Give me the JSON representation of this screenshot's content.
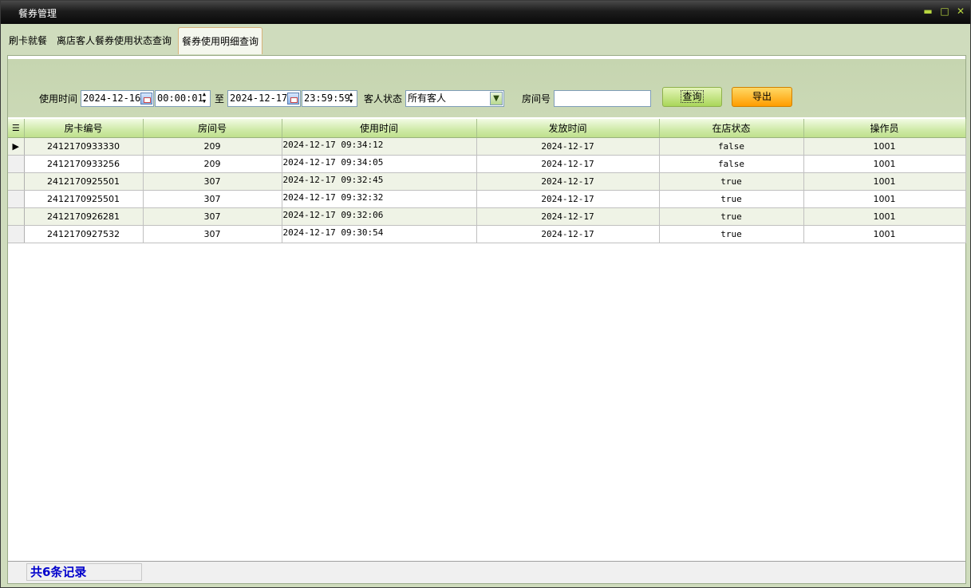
{
  "window": {
    "title": "餐券管理"
  },
  "tabs": [
    {
      "label": "刷卡就餐"
    },
    {
      "label": "离店客人餐券使用状态查询"
    },
    {
      "label": "餐券使用明细查询",
      "active": true
    }
  ],
  "filter": {
    "use_time_label": "使用时间",
    "date_from": "2024-12-16",
    "time_from": "00:00:01",
    "to_label": "至",
    "date_to": "2024-12-17",
    "time_to": "23:59:59",
    "guest_status_label": "客人状态",
    "guest_status_value": "所有客人",
    "room_label": "房间号",
    "room_value": "",
    "query_button": "查询",
    "export_button": "导出"
  },
  "grid": {
    "columns": [
      "房卡编号",
      "房间号",
      "使用时间",
      "发放时间",
      "在店状态",
      "操作员"
    ],
    "rows": [
      {
        "card": "2412170933330",
        "room": "209",
        "use_time": "2024-12-17 09:34:12",
        "issue_time": "2024-12-17",
        "status": "false",
        "operator": "1001"
      },
      {
        "card": "2412170933256",
        "room": "209",
        "use_time": "2024-12-17 09:34:05",
        "issue_time": "2024-12-17",
        "status": "false",
        "operator": "1001"
      },
      {
        "card": "2412170925501",
        "room": "307",
        "use_time": "2024-12-17 09:32:45",
        "issue_time": "2024-12-17",
        "status": "true",
        "operator": "1001"
      },
      {
        "card": "2412170925501",
        "room": "307",
        "use_time": "2024-12-17 09:32:32",
        "issue_time": "2024-12-17",
        "status": "true",
        "operator": "1001"
      },
      {
        "card": "2412170926281",
        "room": "307",
        "use_time": "2024-12-17 09:32:06",
        "issue_time": "2024-12-17",
        "status": "true",
        "operator": "1001"
      },
      {
        "card": "2412170927532",
        "room": "307",
        "use_time": "2024-12-17 09:30:54",
        "issue_time": "2024-12-17",
        "status": "true",
        "operator": "1001"
      }
    ]
  },
  "status": {
    "record_count": "共6条记录"
  },
  "colors": {
    "accent_green": "#b8d640",
    "header_green": "#cfeaa8",
    "export_orange": "#ffb000",
    "count_blue": "#0000cc"
  },
  "icons": {
    "minimize": "minimize-icon",
    "maximize": "maximize-icon",
    "close": "close-icon",
    "calendar": "calendar-icon",
    "row_pointer": "row-pointer-icon"
  }
}
